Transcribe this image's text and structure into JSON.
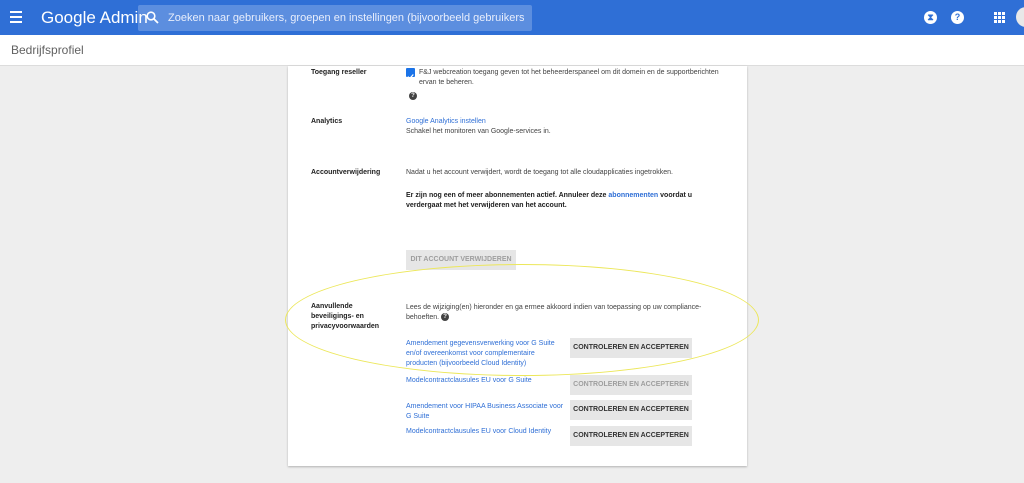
{
  "header": {
    "app_title": "Google Admin",
    "search_placeholder": "Zoeken naar gebruikers, groepen en instellingen (bijvoorbeeld gebruikersgegevens behe",
    "icons": [
      "menu-icon",
      "search-icon",
      "hourglass-icon",
      "help-icon",
      "apps-icon"
    ],
    "accent_color": "#2f6fd6"
  },
  "subheader": {
    "title": "Bedrijfsprofiel"
  },
  "sections": {
    "reseller": {
      "label": "Toegang reseller",
      "checked": true,
      "text": "F&J webcreation toegang geven tot het beheerderspaneel om dit domein en de supportberichten ervan te beheren."
    },
    "analytics": {
      "label": "Analytics",
      "link": "Google Analytics instellen",
      "text": "Schakel het monitoren van Google-services in."
    },
    "account_removal": {
      "label": "Accountverwijdering",
      "text": "Nadat u het account verwijdert, wordt de toegang tot alle cloudapplicaties ingetrokken.",
      "warning_pre": "Er zijn nog een of meer abonnementen actief. Annuleer deze ",
      "warning_link": "abonnementen",
      "warning_post": " voordat u verdergaat met het verwijderen van het account.",
      "button": "DIT ACCOUNT VERWIJDEREN"
    },
    "security_terms": {
      "label_line1": "Aanvullende",
      "label_line2": "beveiligings- en",
      "label_line3": "privacyvoorwaarden",
      "intro": "Lees de wijziging(en) hieronder en ga ermee akkoord indien van toepassing op uw compliance-behoeften.",
      "items": [
        {
          "link": "Amendement gegevensverwerking voor G Suite en/of overeenkomst voor complementaire producten (bijvoorbeeld Cloud Identity)",
          "button": "CONTROLEREN EN ACCEPTEREN"
        },
        {
          "link": "Modelcontractclausules EU voor G Suite",
          "button": "CONTROLEREN EN ACCEPTEREN"
        },
        {
          "link": "Amendement voor HIPAA Business Associate voor G Suite",
          "button": "CONTROLEREN EN ACCEPTEREN"
        },
        {
          "link": "Modelcontractclausules EU voor Cloud Identity",
          "button": "CONTROLEREN EN ACCEPTEREN"
        }
      ]
    }
  },
  "annotation_color": "#ece75a"
}
